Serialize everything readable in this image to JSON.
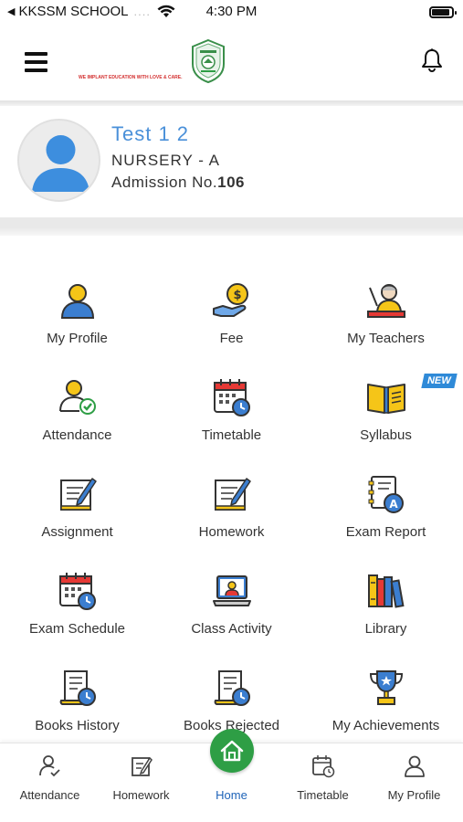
{
  "status_bar": {
    "carrier": "KKSSM SCHOOL",
    "signal": "....",
    "time": "4:30 PM",
    "battery_level": 0.9
  },
  "header": {
    "tagline": "WE IMPLANT EDUCATION WITH LOVE & CARE."
  },
  "student": {
    "name": "Test 1 2",
    "class": "NURSERY - A",
    "admission_label": "Admission No.",
    "admission_no": "106"
  },
  "grid": [
    {
      "label": "My Profile",
      "icon": "user-icon"
    },
    {
      "label": "Fee",
      "icon": "fee-coin-hand-icon"
    },
    {
      "label": "My Teachers",
      "icon": "teacher-icon"
    },
    {
      "label": "Attendance",
      "icon": "attendance-check-icon"
    },
    {
      "label": "Timetable",
      "icon": "calendar-clock-icon"
    },
    {
      "label": "Syllabus",
      "icon": "open-book-icon",
      "badge": "NEW"
    },
    {
      "label": "Assignment",
      "icon": "notepad-pen-icon"
    },
    {
      "label": "Homework",
      "icon": "notepad-pen-icon"
    },
    {
      "label": "Exam Report",
      "icon": "report-grade-icon"
    },
    {
      "label": "Exam Schedule",
      "icon": "calendar-clock-icon"
    },
    {
      "label": "Class Activity",
      "icon": "laptop-user-icon"
    },
    {
      "label": "Library",
      "icon": "books-shelf-icon"
    },
    {
      "label": "Books History",
      "icon": "scroll-clock-icon"
    },
    {
      "label": "Books Rejected",
      "icon": "scroll-clock-icon"
    },
    {
      "label": "My Achievements",
      "icon": "trophy-icon"
    }
  ],
  "bottom_nav": [
    {
      "label": "Attendance",
      "icon": "user-check-icon"
    },
    {
      "label": "Homework",
      "icon": "notepad-pen-icon"
    },
    {
      "label": "Home",
      "icon": "home-icon",
      "active": true
    },
    {
      "label": "Timetable",
      "icon": "calendar-clock-icon"
    },
    {
      "label": "My Profile",
      "icon": "user-outline-icon"
    }
  ],
  "colors": {
    "accent_blue": "#4a90d9",
    "home_green": "#2e9e45",
    "active_nav": "#1e63b8",
    "badge_blue": "#2f8ad8"
  }
}
